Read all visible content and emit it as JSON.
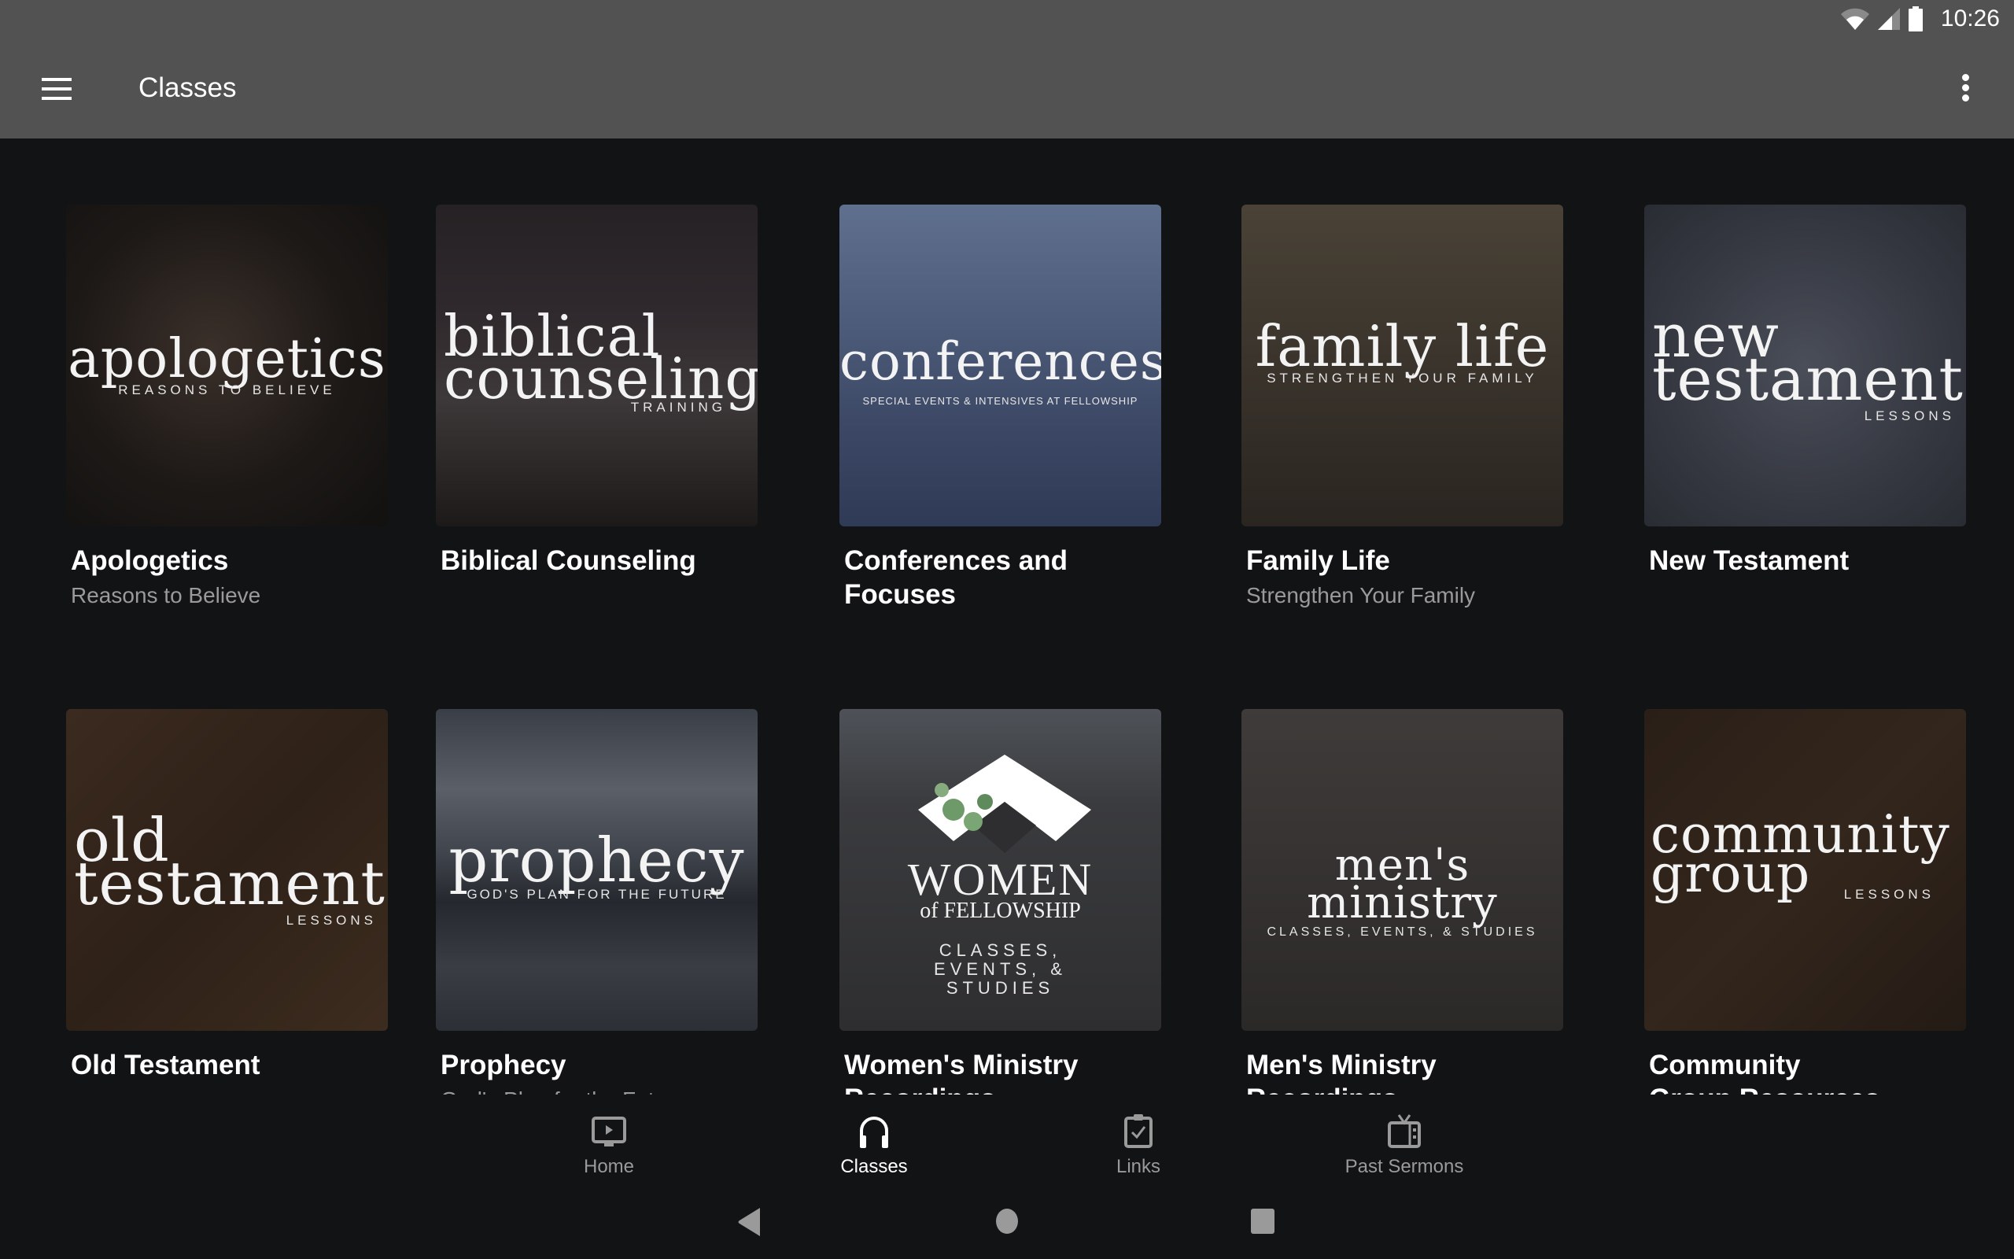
{
  "status_bar": {
    "time": "10:26",
    "icons": [
      "wifi-icon",
      "cell-signal-icon",
      "battery-icon"
    ]
  },
  "app_bar": {
    "title": "Classes",
    "menu_icon": "hamburger-menu-icon",
    "overflow_icon": "more-vert-icon"
  },
  "cards": [
    {
      "title": "Apologetics",
      "subtitle": "Reasons to Believe",
      "art_big": "apologetics",
      "art_small": "REASONS TO BELIEVE"
    },
    {
      "title": "Biblical Counseling",
      "subtitle": "",
      "art_big": "biblical counseling",
      "art_small": "TRAINING"
    },
    {
      "title": "Conferences and Focuses",
      "subtitle": "",
      "art_big": "conferences",
      "art_small": "SPECIAL EVENTS & INTENSIVES AT FELLOWSHIP"
    },
    {
      "title": "Family Life",
      "subtitle": "Strengthen Your Family",
      "art_big": "family life",
      "art_small": "STRENGTHEN YOUR FAMILY"
    },
    {
      "title": "New Testament",
      "subtitle": "",
      "art_big": "new testament",
      "art_small": "LESSONS"
    },
    {
      "title": "Old Testament",
      "subtitle": "",
      "art_big": "old testament",
      "art_small": "LESSONS"
    },
    {
      "title": "Prophecy",
      "subtitle": "God's Plan for the Future",
      "art_big": "prophecy",
      "art_small": "GOD'S PLAN FOR THE FUTURE"
    },
    {
      "title": "Women's Ministry Recordings",
      "subtitle": "",
      "art_big": "WOMEN",
      "art_mid": "of FELLOWSHIP",
      "art_small": "CLASSES, EVENTS, & STUDIES"
    },
    {
      "title": "Men's Ministry Recordings",
      "subtitle": "",
      "art_big": "men's ministry",
      "art_small": "CLASSES, EVENTS, & STUDIES"
    },
    {
      "title": "Community Group Resources",
      "subtitle": "",
      "art_big": "community group",
      "art_small": "LESSONS"
    }
  ],
  "bottom_nav": {
    "items": [
      {
        "label": "Home",
        "icon": "home-tv-play-icon",
        "active": false
      },
      {
        "label": "Classes",
        "icon": "headphones-icon",
        "active": true
      },
      {
        "label": "Links",
        "icon": "clipboard-check-icon",
        "active": false
      },
      {
        "label": "Past Sermons",
        "icon": "tv-icon",
        "active": false
      }
    ]
  },
  "system_nav": {
    "buttons": [
      "back-icon",
      "home-circle-icon",
      "recents-square-icon"
    ]
  },
  "colors": {
    "app_bar": "#525252",
    "background": "#121315",
    "active_nav": "#ffffff",
    "inactive_nav": "#9a9a9a",
    "subtitle": "#9a9a9a"
  }
}
